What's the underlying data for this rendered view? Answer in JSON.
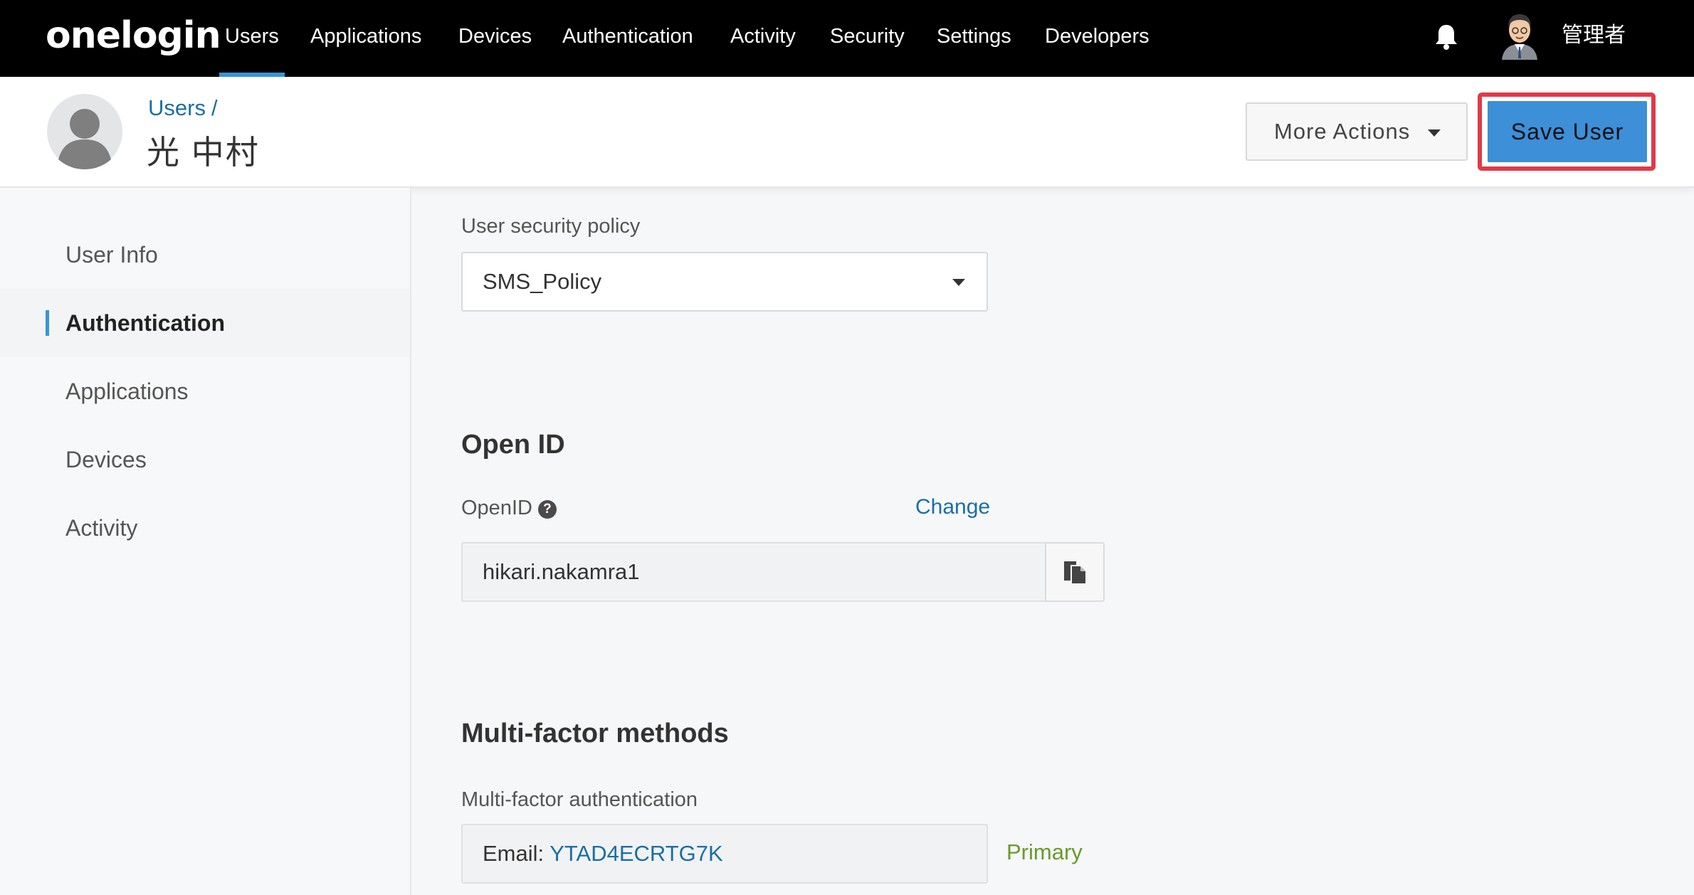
{
  "nav": {
    "logo": "onelogin",
    "items": [
      "Users",
      "Applications",
      "Devices",
      "Authentication",
      "Activity",
      "Security",
      "Settings",
      "Developers"
    ],
    "active_index": 0,
    "admin_name": "管理者",
    "accent_color": "#3795d6"
  },
  "header": {
    "breadcrumb": "Users",
    "breadcrumb_sep": "/",
    "title": "光 中村",
    "more_actions_label": "More Actions",
    "save_label": "Save User"
  },
  "sidebar": {
    "items": [
      "User Info",
      "Authentication",
      "Applications",
      "Devices",
      "Activity"
    ],
    "active_index": 1
  },
  "main": {
    "security_policy": {
      "label": "User security policy",
      "value": "SMS_Policy"
    },
    "open_id": {
      "section_title": "Open ID",
      "label": "OpenID",
      "help_glyph": "?",
      "change_label": "Change",
      "value": "hikari.nakamra1"
    },
    "mfa": {
      "section_title": "Multi-factor methods",
      "label": "Multi-factor authentication",
      "method_prefix": "Email:",
      "method_value": "YTAD4ECRTG7K",
      "status": "Primary"
    }
  }
}
